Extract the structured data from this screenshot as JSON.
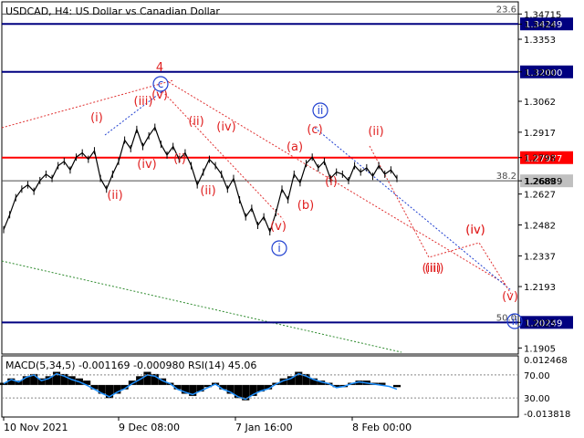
{
  "chart_data": [
    {
      "type": "candlestick",
      "panel": "price",
      "symbol": "USDCAD",
      "timeframe": "H4",
      "description": "US Dollar vs Canadian Dollar",
      "ylim": [
        1.1885,
        1.352
      ],
      "x_labels": [
        "10 Nov 2021",
        "9 Dec 08:00",
        "7 Jan 16:00",
        "8 Feb 00:00"
      ],
      "y_ticks": [
        1.34715,
        1.3424,
        1.3353,
        1.32,
        1.3062,
        1.2917,
        1.2798,
        1.2689,
        1.2627,
        1.2482,
        1.2337,
        1.2193,
        1.2025,
        1.1905
      ],
      "price_path": [
        [
          0,
          1.246
        ],
        [
          2,
          1.253
        ],
        [
          4,
          1.261
        ],
        [
          6,
          1.265
        ],
        [
          8,
          1.267
        ],
        [
          10,
          1.264
        ],
        [
          12,
          1.269
        ],
        [
          14,
          1.272
        ],
        [
          16,
          1.27
        ],
        [
          18,
          1.276
        ],
        [
          20,
          1.278
        ],
        [
          22,
          1.274
        ],
        [
          24,
          1.28
        ],
        [
          26,
          1.282
        ],
        [
          28,
          1.279
        ],
        [
          30,
          1.283
        ],
        [
          32,
          1.27
        ],
        [
          34,
          1.265
        ],
        [
          36,
          1.272
        ],
        [
          38,
          1.278
        ],
        [
          40,
          1.288
        ],
        [
          42,
          1.284
        ],
        [
          44,
          1.293
        ],
        [
          46,
          1.285
        ],
        [
          48,
          1.29
        ],
        [
          50,
          1.294
        ],
        [
          52,
          1.286
        ],
        [
          54,
          1.281
        ],
        [
          56,
          1.285
        ],
        [
          58,
          1.279
        ],
        [
          60,
          1.282
        ],
        [
          62,
          1.276
        ],
        [
          64,
          1.267
        ],
        [
          66,
          1.273
        ],
        [
          68,
          1.279
        ],
        [
          70,
          1.276
        ],
        [
          72,
          1.272
        ],
        [
          74,
          1.265
        ],
        [
          76,
          1.27
        ],
        [
          78,
          1.26
        ],
        [
          80,
          1.252
        ],
        [
          82,
          1.256
        ],
        [
          84,
          1.248
        ],
        [
          86,
          1.252
        ],
        [
          88,
          1.245
        ],
        [
          90,
          1.254
        ],
        [
          92,
          1.265
        ],
        [
          94,
          1.26
        ],
        [
          96,
          1.272
        ],
        [
          98,
          1.268
        ],
        [
          100,
          1.277
        ],
        [
          102,
          1.28
        ],
        [
          104,
          1.275
        ],
        [
          106,
          1.278
        ],
        [
          108,
          1.27
        ],
        [
          110,
          1.273
        ],
        [
          112,
          1.272
        ],
        [
          114,
          1.269
        ],
        [
          116,
          1.276
        ],
        [
          118,
          1.273
        ],
        [
          120,
          1.275
        ],
        [
          122,
          1.271
        ],
        [
          124,
          1.276
        ],
        [
          126,
          1.272
        ],
        [
          128,
          1.274
        ],
        [
          130,
          1.27
        ]
      ],
      "horizontal_levels": [
        {
          "value": 1.34715,
          "label": "23.6",
          "color": "#4a4a4a"
        },
        {
          "value": 1.34249,
          "label": "1.34249",
          "color": "#000080",
          "tag_bg": "#000080"
        },
        {
          "value": 1.32,
          "label": "1.32000",
          "color": "#000080",
          "tag_bg": "#000080"
        },
        {
          "value": 1.27977,
          "label": "1.27977",
          "color": "#ff0000",
          "tag_bg": "#ff0000"
        },
        {
          "value": 1.26889,
          "label": "38.2",
          "color": "#4a4a4a",
          "tag": "1.26889",
          "tag_bg": "#c0c0c0"
        },
        {
          "value": 1.20249,
          "label": "50.0",
          "color": "#000080",
          "tag_bg": "#000080",
          "tag": "1.20249"
        }
      ],
      "wave_labels_red": [
        "4",
        "(iii)",
        "(v)",
        "(i)",
        "(ii)",
        "(iv)",
        "(ii)",
        "(iv)",
        "(i)",
        "(ii)",
        "(iii)",
        "(iv)",
        "(v)",
        "(a)",
        "(c)",
        "(b)",
        "(i)",
        "(ii)",
        "(iii)",
        "(iv)",
        "(v)"
      ],
      "wave_labels_blue": [
        "c",
        "i",
        "ii",
        "ii"
      ]
    },
    {
      "type": "histogram",
      "panel": "indicator",
      "title": "MACD(5,34,5) -0.001169 -0.000980 RSI(14) 45.06",
      "ylim": [
        -0.013818,
        0.012468
      ],
      "y_ticks": [
        "0.012468",
        "70.00",
        "30.00",
        "-0.013818"
      ],
      "macd_values": [
        0.001,
        0.003,
        0.002,
        0.004,
        0.005,
        0.003,
        0.004,
        0.006,
        0.005,
        0.004,
        0.003,
        0.002,
        -0.002,
        -0.004,
        -0.006,
        -0.004,
        -0.002,
        0.002,
        0.004,
        0.006,
        0.005,
        0.003,
        0.001,
        -0.002,
        -0.004,
        -0.005,
        -0.003,
        -0.001,
        0.001,
        -0.002,
        -0.004,
        -0.006,
        -0.007,
        -0.005,
        -0.003,
        -0.002,
        0.001,
        0.003,
        0.004,
        0.006,
        0.005,
        0.003,
        0.002,
        0.001,
        -0.001,
        -0.001,
        0.001,
        0.002,
        0.002,
        0.001,
        0.001,
        0.0,
        -0.001
      ],
      "rsi_values": [
        55,
        62,
        58,
        66,
        70,
        60,
        64,
        72,
        68,
        62,
        58,
        52,
        45,
        38,
        32,
        40,
        46,
        55,
        62,
        70,
        68,
        60,
        55,
        45,
        40,
        36,
        42,
        48,
        54,
        45,
        40,
        32,
        28,
        36,
        42,
        46,
        54,
        60,
        64,
        72,
        68,
        62,
        58,
        55,
        48,
        50,
        55,
        58,
        56,
        54,
        52,
        50,
        45
      ]
    }
  ]
}
